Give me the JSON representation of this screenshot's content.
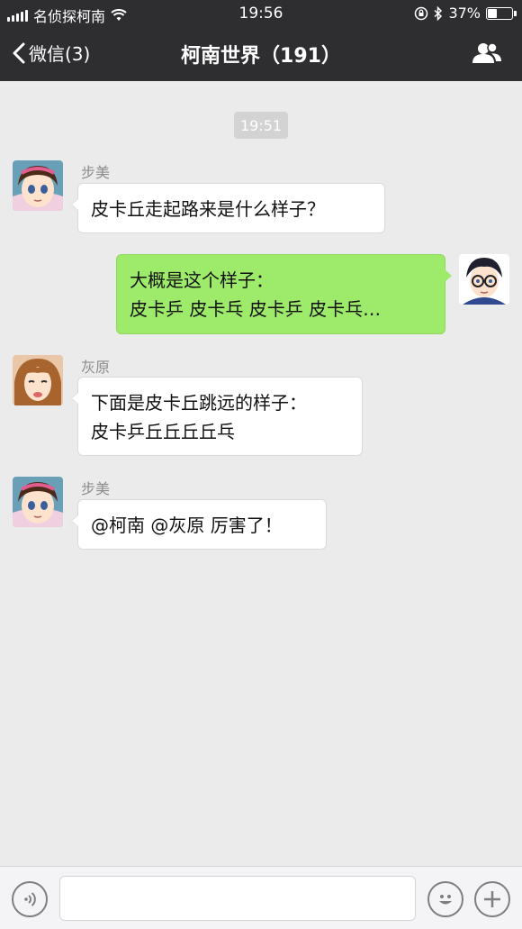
{
  "status_bar": {
    "carrier": "名侦探柯南",
    "time": "19:56",
    "battery": "37%",
    "battery_level": 0.37
  },
  "nav": {
    "back_label": "微信(3)",
    "title": "柯南世界（191）",
    "group_icon": "group-people-icon"
  },
  "chat": {
    "timestamp": "19:51",
    "messages": [
      {
        "sender": "步美",
        "side": "left",
        "text": "皮卡丘走起路来是什么样子？"
      },
      {
        "sender": "",
        "side": "right",
        "text": "大概是这个样子：\n皮卡乒 皮卡乓 皮卡乒 皮卡乓…"
      },
      {
        "sender": "灰原",
        "side": "left",
        "text": "下面是皮卡丘跳远的样子：\n皮卡乒丘丘丘丘乓"
      },
      {
        "sender": "步美",
        "side": "left",
        "text": "@柯南 @灰原 厉害了！"
      }
    ]
  },
  "input_bar": {
    "voice_icon": "voice-icon",
    "emoji_icon": "emoji-icon",
    "plus_icon": "plus-icon",
    "text_value": ""
  }
}
